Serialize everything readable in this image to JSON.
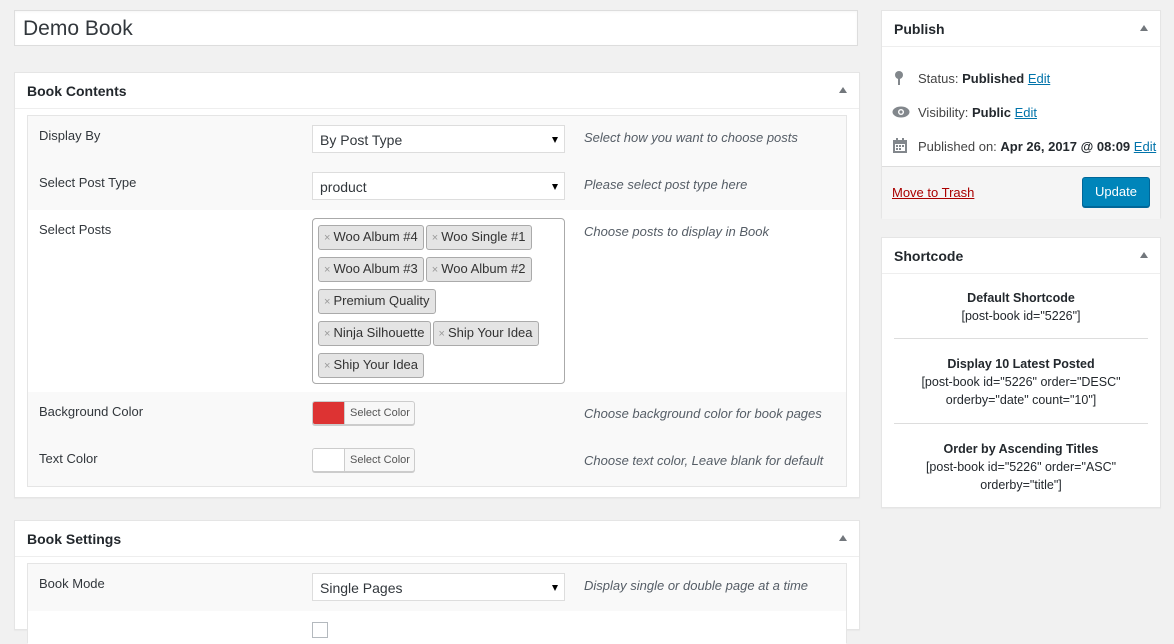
{
  "post_title": "Demo Book",
  "book_contents": {
    "title": "Book Contents",
    "rows": {
      "display_by": {
        "label": "Display By",
        "value": "By Post Type",
        "desc": "Select how you want to choose posts"
      },
      "post_type": {
        "label": "Select Post Type",
        "value": "product",
        "desc": "Please select post type here"
      },
      "posts": {
        "label": "Select Posts",
        "desc": "Choose posts to display in Book",
        "tags": [
          "Woo Album #4",
          "Woo Single #1",
          "Woo Album #3",
          "Woo Album #2",
          "Premium Quality",
          "Ninja Silhouette",
          "Ship Your Idea",
          "Ship Your Idea"
        ]
      },
      "bg_color": {
        "label": "Background Color",
        "button": "Select Color",
        "color": "#dd3333",
        "desc": "Choose background color for book pages"
      },
      "text_color": {
        "label": "Text Color",
        "button": "Select Color",
        "color": "#ffffff",
        "desc": "Choose text color, Leave blank for default"
      }
    }
  },
  "book_settings": {
    "title": "Book Settings",
    "rows": {
      "mode": {
        "label": "Book Mode",
        "value": "Single Pages",
        "desc": "Display single or double page at a time"
      }
    }
  },
  "publish": {
    "title": "Publish",
    "status_label": "Status:",
    "status_value": "Published",
    "visibility_label": "Visibility:",
    "visibility_value": "Public",
    "published_label": "Published on:",
    "published_value": "Apr 26, 2017 @ 08:09",
    "edit": "Edit",
    "trash": "Move to Trash",
    "update": "Update"
  },
  "shortcode": {
    "title": "Shortcode",
    "blocks": [
      {
        "title": "Default Shortcode",
        "line1": "[post-book id=\"5226\"]",
        "line2": ""
      },
      {
        "title": "Display 10 Latest Posted",
        "line1": "[post-book id=\"5226\" order=\"DESC\"",
        "line2": "orderby=\"date\" count=\"10\"]"
      },
      {
        "title": "Order by Ascending Titles",
        "line1": "[post-book id=\"5226\" order=\"ASC\"",
        "line2": "orderby=\"title\"]"
      }
    ]
  }
}
